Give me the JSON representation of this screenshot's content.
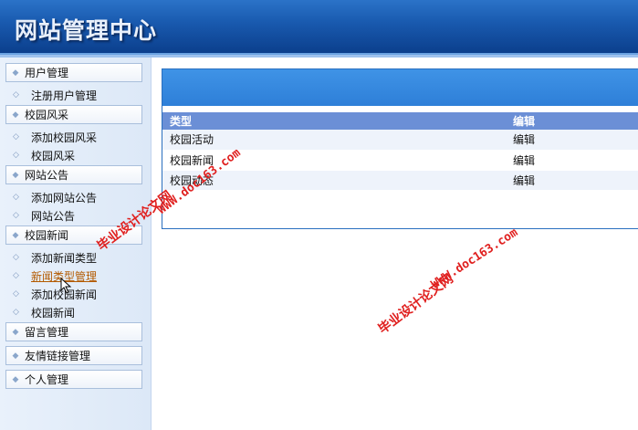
{
  "header": {
    "title": "网站管理中心"
  },
  "sidebar": {
    "groups": [
      {
        "label": "用户管理",
        "items": [
          "注册用户管理"
        ]
      },
      {
        "label": "校园风采",
        "items": [
          "添加校园风采",
          "校园风采"
        ]
      },
      {
        "label": "网站公告",
        "items": [
          "添加网站公告",
          "网站公告"
        ]
      },
      {
        "label": "校园新闻",
        "items": [
          "添加新闻类型",
          "新闻类型管理",
          "添加校园新闻",
          "校园新闻"
        ]
      },
      {
        "label": "留言管理",
        "items": []
      },
      {
        "label": "友情链接管理",
        "items": []
      },
      {
        "label": "个人管理",
        "items": []
      }
    ],
    "active_item": "新闻类型管理"
  },
  "table": {
    "headers": [
      "类型",
      "编辑"
    ],
    "rows": [
      {
        "type": "校园活动",
        "action": "编辑"
      },
      {
        "type": "校园新闻",
        "action": "编辑"
      },
      {
        "type": "校园动态",
        "action": "编辑"
      }
    ]
  },
  "watermark": {
    "text": "毕业设计论文网",
    "url": "WWW.doc163.com"
  },
  "colors": {
    "header": "#1a5bb0",
    "panel_bar": "#3f93e6",
    "table_header": "#6b8fd6",
    "watermark": "#e0201f",
    "active_link": "#b35a00"
  }
}
